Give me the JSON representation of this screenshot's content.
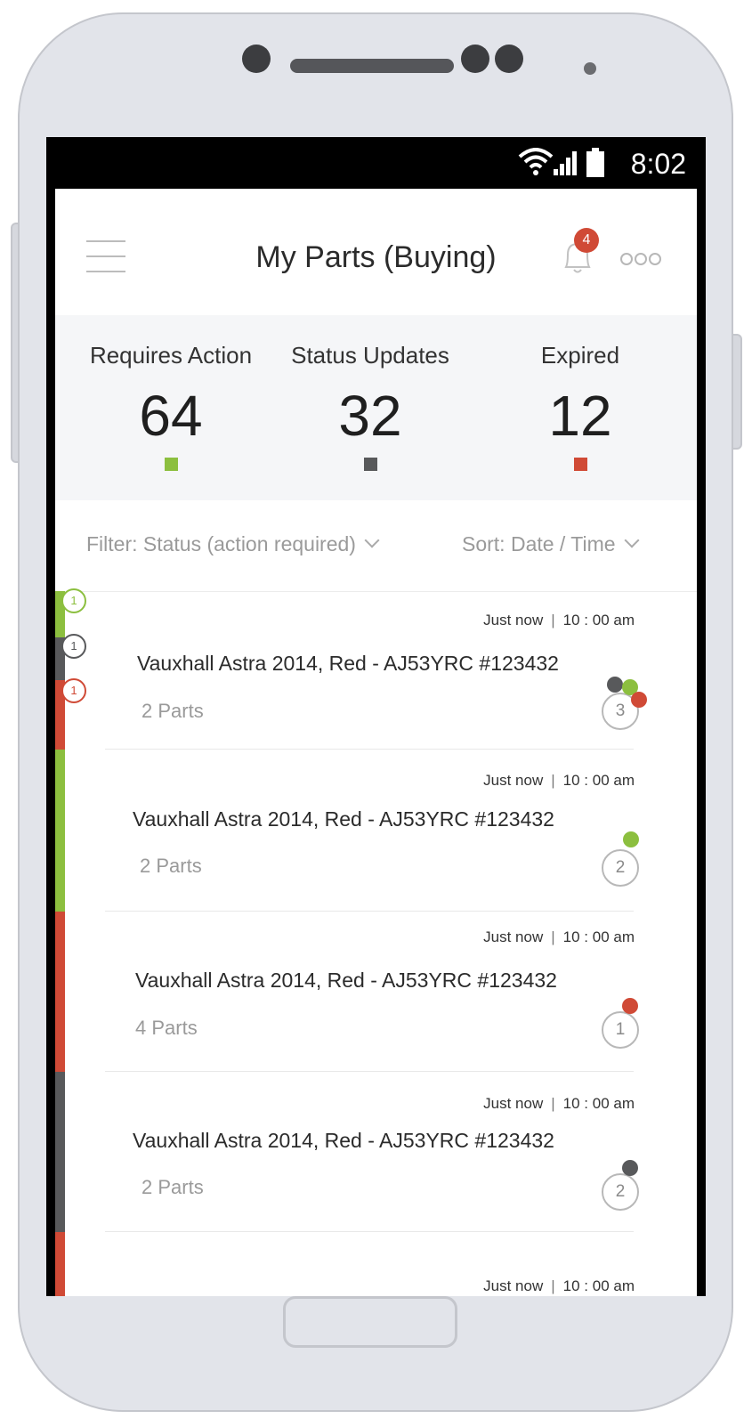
{
  "statusbar": {
    "time": "8:02"
  },
  "header": {
    "title": "My Parts (Buying)",
    "notifications": "4"
  },
  "stats": [
    {
      "label": "Requires Action",
      "value": "64",
      "color": "#8cbf3f"
    },
    {
      "label": "Status Updates",
      "value": "32",
      "color": "#58595b"
    },
    {
      "label": "Expired",
      "value": "12",
      "color": "#d04a36"
    }
  ],
  "filter": {
    "label": "Filter: Status (action required)"
  },
  "sort": {
    "label": "Sort: Date / Time"
  },
  "colors": {
    "green": "#8cbf3f",
    "grey": "#58595b",
    "red": "#d04a36"
  },
  "list": [
    {
      "time_ago": "Just now",
      "time": "10 : 00 am",
      "title": "Vauxhall Astra 2014, Red  - AJ53YRC  #123432",
      "parts": "2  Parts",
      "count": "3",
      "markers": [
        "1",
        "1",
        "1"
      ]
    },
    {
      "time_ago": "Just now",
      "time": "10 : 00 am",
      "title": "Vauxhall Astra 2014, Red  - AJ53YRC  #123432",
      "parts": "2  Parts",
      "count": "2"
    },
    {
      "time_ago": "Just now",
      "time": "10 : 00 am",
      "title": "Vauxhall Astra 2014, Red  - AJ53YRC  #123432",
      "parts": "4 Parts",
      "count": "1"
    },
    {
      "time_ago": "Just now",
      "time": "10 : 00 am",
      "title": "Vauxhall Astra 2014, Red  - AJ53YRC  #123432",
      "parts": "2 Parts",
      "count": "2"
    },
    {
      "time_ago": "Just now",
      "time": "10 : 00 am"
    }
  ]
}
